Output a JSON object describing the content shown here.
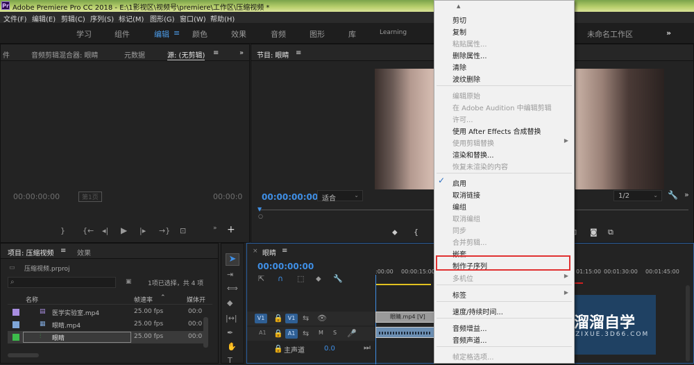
{
  "titlebar": {
    "logo": "Pr",
    "title": "Adobe Premiere Pro CC 2018 - E:\\1影视区\\视频号\\premiere\\工作区\\压缩视频 *"
  },
  "menubar": {
    "items": [
      "文件(F)",
      "编辑(E)",
      "剪辑(C)",
      "序列(S)",
      "标记(M)",
      "图形(G)",
      "窗口(W)",
      "帮助(H)"
    ]
  },
  "workspaces": {
    "items": [
      "学习",
      "组件",
      "编辑",
      "颜色",
      "效果",
      "音频",
      "图形",
      "库",
      "Learning"
    ],
    "active": "编辑",
    "unnamed": "未命名工作区",
    "more": "»"
  },
  "source_panel": {
    "tab_partial": "件",
    "tabs": [
      "音频剪辑混合器: 眼睛",
      "元数据",
      "源: (无剪辑)"
    ],
    "timecode_left": "00:00:00:00",
    "page_indicator": "第1页",
    "timecode_right": "00:00:0"
  },
  "program_panel": {
    "tab": "节目: 眼睛",
    "timecode": "00:00:00:00",
    "fit": "适合",
    "quality": "1/2"
  },
  "project_panel": {
    "tabs": [
      "项目: 压缩视频",
      "效果"
    ],
    "filename": "压缩视频.prproj",
    "selection_status": "1项已选择，共 4 项",
    "columns": [
      "名称",
      "帧速率",
      "媒体开"
    ],
    "rows": [
      {
        "name": "医学实验室.mp4",
        "fps": "25.00 fps",
        "start": "00:0",
        "color": "#a88de0"
      },
      {
        "name": "眼睛.mp4",
        "fps": "25.00 fps",
        "start": "00:0",
        "color": "#7fa6d8"
      },
      {
        "name": "眼睛",
        "fps": "25.00 fps",
        "start": "00:0",
        "color": "#3dbb4b"
      }
    ]
  },
  "timeline": {
    "tab": "眼睛",
    "timecode": "00:00:00:00",
    "ruler": [
      ":00:00",
      "00:00:15:00",
      "01:15:00",
      "00:01:30:00",
      "00:01:45:00"
    ],
    "tracks": {
      "v1_label": "V1",
      "a1_label": "A1",
      "master": "主声道",
      "master_value": "0.0"
    },
    "clip_video": "眼睛.mp4 [V]"
  },
  "context_menu": {
    "items": [
      {
        "label": "剪切",
        "enabled": true
      },
      {
        "label": "复制",
        "enabled": true
      },
      {
        "label": "粘贴属性...",
        "enabled": false
      },
      {
        "label": "删除属性...",
        "enabled": true
      },
      {
        "label": "清除",
        "enabled": true
      },
      {
        "label": "波纹删除",
        "enabled": true
      },
      {
        "label": "编辑原始",
        "enabled": false
      },
      {
        "label": "在 Adobe Audition 中编辑剪辑",
        "enabled": false
      },
      {
        "label": "许可...",
        "enabled": false
      },
      {
        "label": "使用 After Effects 合成替换",
        "enabled": true
      },
      {
        "label": "使用剪辑替换",
        "enabled": false,
        "submenu": true
      },
      {
        "label": "渲染和替换...",
        "enabled": true
      },
      {
        "label": "恢复未渲染的内容",
        "enabled": false
      },
      {
        "label": "启用",
        "enabled": true,
        "checked": true
      },
      {
        "label": "取消链接",
        "enabled": true
      },
      {
        "label": "编组",
        "enabled": true
      },
      {
        "label": "取消编组",
        "enabled": false
      },
      {
        "label": "同步",
        "enabled": false
      },
      {
        "label": "合并剪辑...",
        "enabled": false
      },
      {
        "label": "嵌套...",
        "enabled": true
      },
      {
        "label": "制作子序列",
        "enabled": true,
        "highlighted": true
      },
      {
        "label": "多机位",
        "enabled": false,
        "submenu": true
      },
      {
        "label": "标签",
        "enabled": true,
        "submenu": true
      },
      {
        "label": "速度/持续时间...",
        "enabled": true
      },
      {
        "label": "音频增益...",
        "enabled": true
      },
      {
        "label": "音频声道...",
        "enabled": true
      },
      {
        "label": "帧定格选项...",
        "enabled": false
      }
    ]
  },
  "watermark": {
    "name": "溜溜自学",
    "url": "ZIXUE.3D66.COM"
  }
}
